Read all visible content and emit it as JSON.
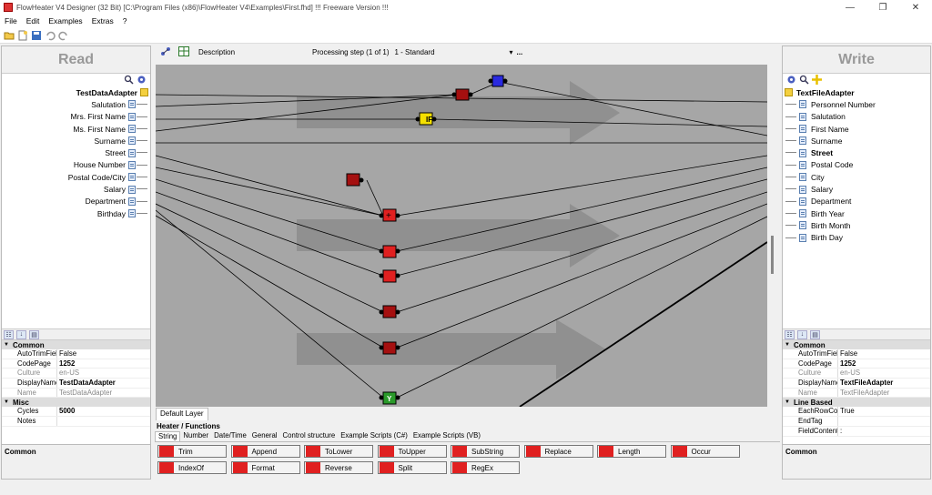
{
  "window": {
    "title": "FlowHeater V4 Designer (32 Bit) [C:\\Program Files (x86)\\FlowHeater V4\\Examples\\First.fhd] !!! Freeware Version !!!",
    "controls": [
      "—",
      "❐",
      "✕"
    ]
  },
  "menu": [
    "File",
    "Edit",
    "Examples",
    "Extras",
    "?"
  ],
  "read_panel": {
    "title": "Read",
    "adapter": "TestDataAdapter",
    "fields": [
      "Salutation",
      "Mrs. First Name",
      "Ms. First Name",
      "Surname",
      "Street",
      "House Number",
      "Postal Code/City",
      "Salary",
      "Department",
      "Birthday"
    ]
  },
  "write_panel": {
    "title": "Write",
    "adapter": "TextFileAdapter",
    "fields": [
      "Personnel Number",
      "Salutation",
      "First Name",
      "Surname",
      "Street",
      "Postal Code",
      "City",
      "Salary",
      "Department",
      "Birth Year",
      "Birth Month",
      "Birth Day"
    ]
  },
  "center": {
    "description_label": "Description",
    "processing_label": "Processing step (1 of 1)",
    "processing_value": "1 - Standard",
    "more": "...",
    "layer_tab": "Default Layer"
  },
  "canvas": {
    "if_label": "IF",
    "y_label": "Y"
  },
  "left_props": {
    "cat1": "Common",
    "rows1": [
      [
        "AutoTrimFields",
        "False"
      ],
      [
        "CodePage",
        "1252"
      ],
      [
        "Culture",
        "en-US"
      ],
      [
        "DisplayName",
        "TestDataAdapter"
      ],
      [
        "Name",
        "TestDataAdapter"
      ]
    ],
    "cat2": "Misc",
    "rows2": [
      [
        "Cycles",
        "5000"
      ],
      [
        "Notes",
        ""
      ]
    ],
    "desc": "Common"
  },
  "right_props": {
    "cat1": "Common",
    "rows1": [
      [
        "AutoTrimFields",
        "False"
      ],
      [
        "CodePage",
        "1252"
      ],
      [
        "Culture",
        "en-US"
      ],
      [
        "DisplayName",
        "TextFileAdapter"
      ],
      [
        "Name",
        "TextFileAdapter"
      ]
    ],
    "cat2": "Line Based",
    "rows2": [
      [
        "EachRowContains",
        "True"
      ],
      [
        "EndTag",
        ""
      ],
      [
        "FieldContentSepar",
        ":"
      ]
    ],
    "desc": "Common"
  },
  "heater": {
    "title": "Heater / Functions",
    "tabs": [
      "String",
      "Number",
      "Date/Time",
      "General",
      "Control structure",
      "Example Scripts (C#)",
      "Example Scripts (VB)"
    ],
    "row1": [
      "Trim",
      "Append",
      "ToLower",
      "ToUpper",
      "SubString",
      "Replace",
      "Length",
      "Occur"
    ],
    "row2": [
      "IndexOf",
      "Format",
      "Reverse",
      "Split",
      "RegEx"
    ]
  }
}
